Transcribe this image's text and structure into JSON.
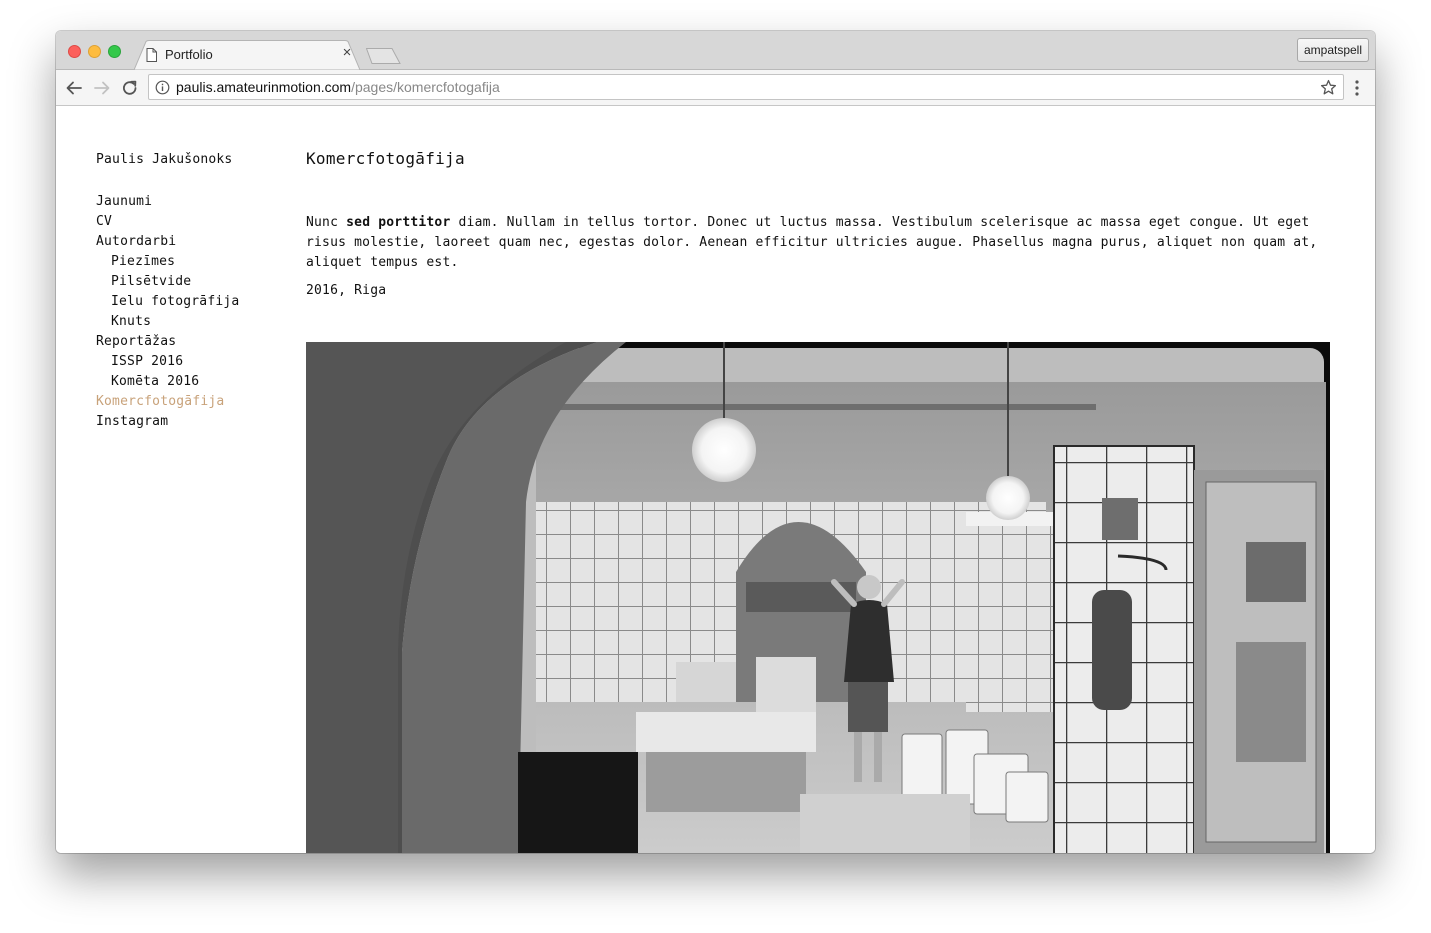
{
  "browser": {
    "tab_title": "Portfolio",
    "tab_close_glyph": "×",
    "profile_name": "ampatspell",
    "url_host": "paulis.amateurinmotion.com",
    "url_path": "/pages/komercfotogafija",
    "icons": {
      "back": "arrow-left-icon",
      "forward": "arrow-right-icon",
      "reload": "reload-icon",
      "info": "info-icon",
      "bookmark": "star-icon",
      "menu": "kebab-menu-icon",
      "page": "document-icon"
    }
  },
  "site": {
    "name": "Paulis Jakušonoks"
  },
  "nav": {
    "items": [
      {
        "label": "Jaunumi",
        "level": 0,
        "active": false
      },
      {
        "label": "CV",
        "level": 0,
        "active": false
      },
      {
        "label": "Autordarbi",
        "level": 0,
        "active": false
      },
      {
        "label": "Piezīmes",
        "level": 1,
        "active": false
      },
      {
        "label": "Pilsētvide",
        "level": 1,
        "active": false
      },
      {
        "label": "Ielu fotogrāfija",
        "level": 1,
        "active": false
      },
      {
        "label": "Knuts",
        "level": 1,
        "active": false
      },
      {
        "label": "Reportāžas",
        "level": 0,
        "active": false
      },
      {
        "label": "ISSP 2016",
        "level": 1,
        "active": false
      },
      {
        "label": "Komēta 2016",
        "level": 1,
        "active": false
      },
      {
        "label": "Komercfotogāfija",
        "level": 0,
        "active": true
      },
      {
        "label": "Instagram",
        "level": 0,
        "active": false
      }
    ],
    "active_color": "#c8a27a"
  },
  "content": {
    "title": "Komercfotogāfija",
    "desc_start": "Nunc ",
    "desc_bold": "sed porttitor",
    "desc_rest": " diam. Nullam in tellus tortor. Donec ut luctus massa. Vestibulum scelerisque ac massa eget congue. Ut eget risus molestie, laoreet quam nec, egestas dolor. Aenean efficitur ultricies augue. Phasellus magna purus, aliquet non quam at, aliquet tempus est.",
    "meta": "2016, Riga"
  }
}
